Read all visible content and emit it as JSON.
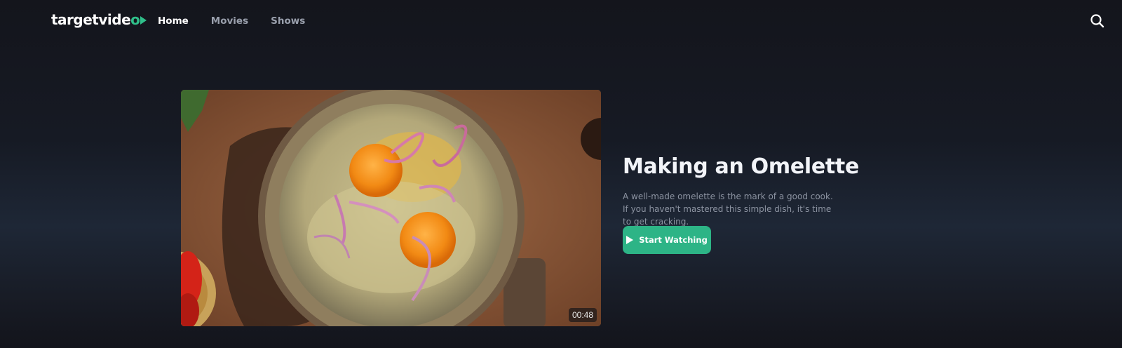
{
  "brand": {
    "part1": "targetvide",
    "part2": "o"
  },
  "nav": {
    "items": [
      {
        "label": "Home",
        "active": true
      },
      {
        "label": "Movies",
        "active": false
      },
      {
        "label": "Shows",
        "active": false
      }
    ]
  },
  "search": {
    "icon": "search-icon"
  },
  "feature": {
    "title": "Making an Omelette",
    "description": "A well-made omelette is the mark of a good cook. If you haven't mastered this simple dish, it's time to get cracking.",
    "cta_label": "Start Watching",
    "duration": "00:48"
  },
  "colors": {
    "accent": "#2db486",
    "background": "#14151c"
  }
}
